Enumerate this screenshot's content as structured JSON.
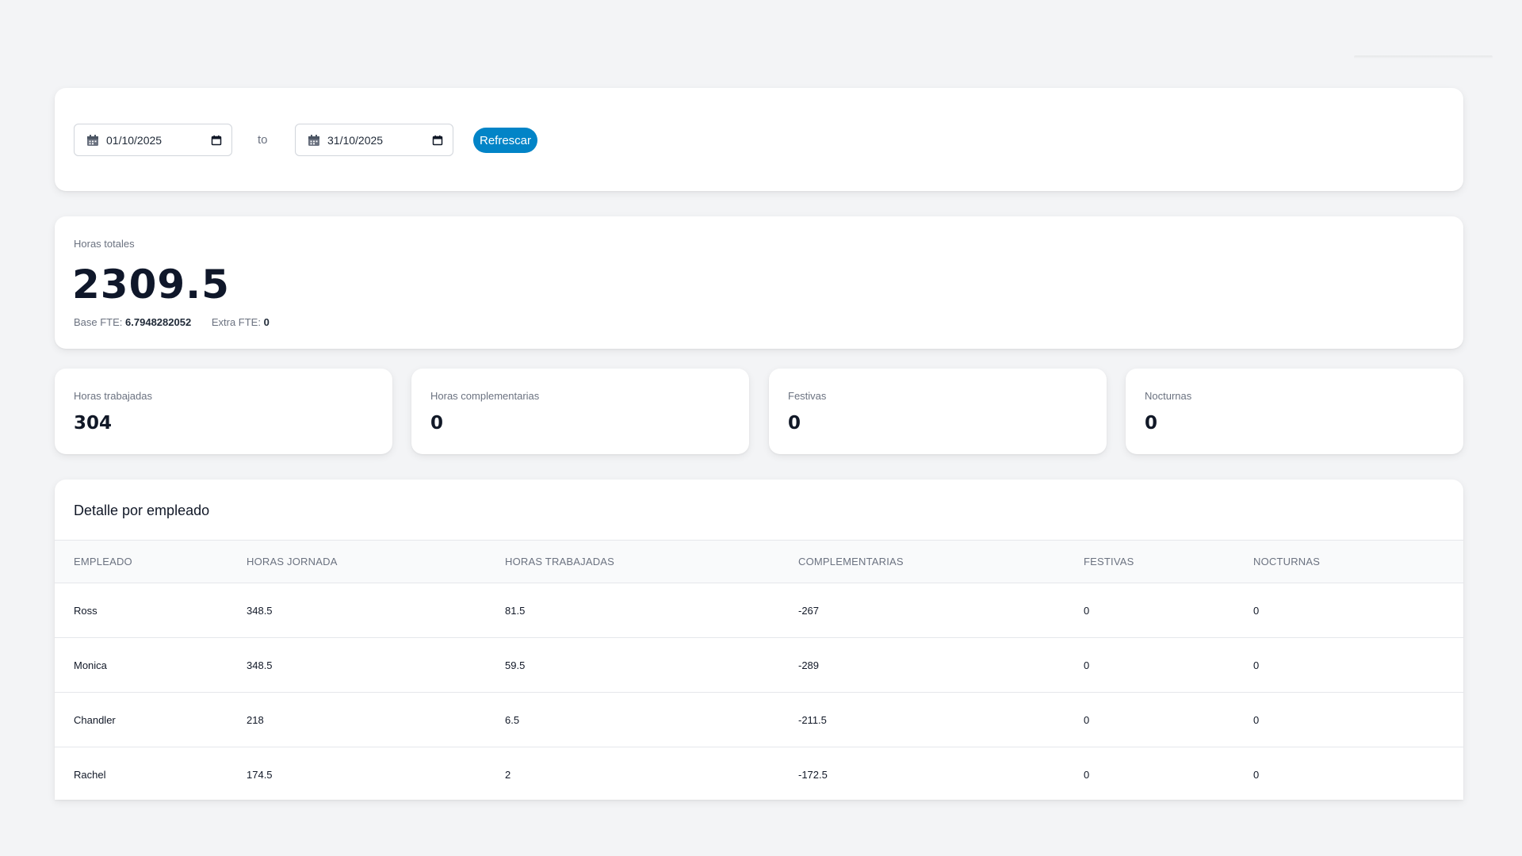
{
  "filters": {
    "from_date": "01/10/2025",
    "to_label": "to",
    "to_date": "31/10/2025",
    "refresh_label": "Refrescar"
  },
  "totals": {
    "label": "Horas totales",
    "value": "2309.5",
    "base_fte_label": "Base FTE:",
    "base_fte_value": "6.7948282052",
    "extra_fte_label": "Extra FTE:",
    "extra_fte_value": "0"
  },
  "stats": [
    {
      "label": "Horas trabajadas",
      "value": "304"
    },
    {
      "label": "Horas complementarias",
      "value": "0"
    },
    {
      "label": "Festivas",
      "value": "0"
    },
    {
      "label": "Nocturnas",
      "value": "0"
    }
  ],
  "table": {
    "title": "Detalle por empleado",
    "columns": [
      "EMPLEADO",
      "HORAS JORNADA",
      "HORAS TRABAJADAS",
      "COMPLEMENTARIAS",
      "FESTIVAS",
      "NOCTURNAS"
    ],
    "rows": [
      [
        "Ross",
        "348.5",
        "81.5",
        "-267",
        "0",
        "0"
      ],
      [
        "Monica",
        "348.5",
        "59.5",
        "-289",
        "0",
        "0"
      ],
      [
        "Chandler",
        "218",
        "6.5",
        "-211.5",
        "0",
        "0"
      ],
      [
        "Rachel",
        "174.5",
        "2",
        "-172.5",
        "0",
        "0"
      ]
    ]
  },
  "colors": {
    "accent": "#0284c7",
    "background": "#f3f4f6",
    "card": "#ffffff"
  }
}
